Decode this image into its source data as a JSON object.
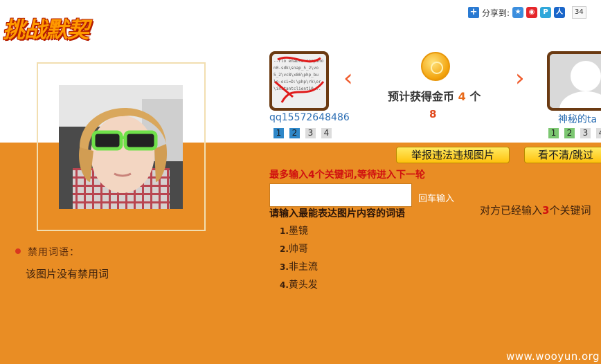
{
  "header": {
    "logo_text": "挑战默契",
    "share_label": "分享到:",
    "share_count": "34",
    "share_icons": [
      "qzone-icon",
      "weibo-icon",
      "pengyou-icon",
      "renren-icon"
    ]
  },
  "left": {
    "forbidden_title": "禁用词语：",
    "forbidden_empty": "该图片没有禁用词"
  },
  "player1": {
    "name": "qq15572648486",
    "pages": [
      "1",
      "2",
      "3",
      "4"
    ],
    "avatar_text": "--rlo enable-snapsho\nn0-sdk\\snap_5_2\\vo\n5_2\\vc8\\x86\\php_bu\nlo-oci=D:\\php\\rk\\orac\n\\instantclient10..."
  },
  "player2": {
    "name": "神秘的ta",
    "pages": [
      "1",
      "2",
      "3",
      "4"
    ]
  },
  "center": {
    "coin_prefix": "预计获得金币",
    "coin_count": "4",
    "coin_suffix": "个",
    "coin_total": "8"
  },
  "buttons": {
    "report": "举报违法违规图片",
    "skip": "看不清/跳过"
  },
  "input_area": {
    "max_hint": "最多输入4个关键词,等待进入下一轮",
    "input_value": "",
    "enter_hint": "回车输入",
    "prompt": "请输入最能表达图片内容的词语",
    "opponent_prefix": "对方已经输入",
    "opponent_count": "3",
    "opponent_suffix": "个关键词"
  },
  "keywords": [
    {
      "index": "1.",
      "word": "墨镜"
    },
    {
      "index": "2.",
      "word": "帅哥"
    },
    {
      "index": "3.",
      "word": "非主流"
    },
    {
      "index": "4.",
      "word": "黄头发"
    }
  ],
  "watermark": "www.wooyun.org",
  "colors": {
    "orange_bg": "#e98d24",
    "accent_red": "#d01010",
    "link_blue": "#2a6db3"
  }
}
